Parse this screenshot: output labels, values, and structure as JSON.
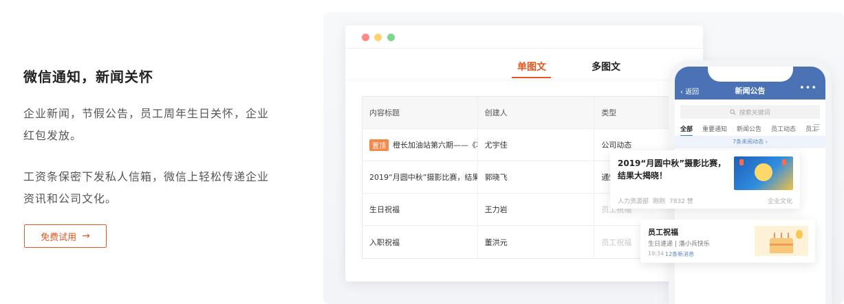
{
  "left": {
    "headline": "微信通知，新闻关怀",
    "desc1": "企业新闻，节假公告，员工周年生日关怀，企业红包发放。",
    "desc2": "工资条保密下发私人信箱，微信上轻松传递企业资讯和公司文化。",
    "cta_label": "免费试用",
    "cta_arrow": "→"
  },
  "browser": {
    "tabs": [
      "单图文",
      "多图文"
    ],
    "table": {
      "headers": [
        "内容标题",
        "创建人",
        "类型"
      ],
      "rows": [
        {
          "badge": "置顶",
          "title": "橙长加油站第六期——《项...",
          "creator": "尤宇佳",
          "type": "公司动态"
        },
        {
          "badge": "",
          "title": "2019“月圆中秋”摄影比赛，结果大...",
          "creator": "郭晓飞",
          "type": "通知"
        },
        {
          "badge": "",
          "title": "生日祝福",
          "creator": "王力岩",
          "type": "员工祝福"
        },
        {
          "badge": "",
          "title": "入职祝福",
          "creator": "董洪元",
          "type": "员工祝福"
        }
      ]
    }
  },
  "phone": {
    "back_label": "返回",
    "title": "新闻公告",
    "more": "•••",
    "search_placeholder": "搜索关键词",
    "categories": [
      "全部",
      "重要通知",
      "新闻公告",
      "员工动态",
      "员工"
    ],
    "unread": "7条未阅动态 ›"
  },
  "card1": {
    "title": "2019“月圆中秋”摄影比赛，结果大揭晓！",
    "dept": "人力资源部",
    "time": "刚刚",
    "likes": "7832 赞",
    "category": "企业文化"
  },
  "card2": {
    "title": "员工祝福",
    "subtitle": "生日速递 | 潘小兵快乐",
    "time": "19:34",
    "new_msgs": "12条新消息"
  },
  "colors": {
    "accent": "#e5561f",
    "phone_header": "#4a72b4",
    "badge": "#f5894a"
  }
}
